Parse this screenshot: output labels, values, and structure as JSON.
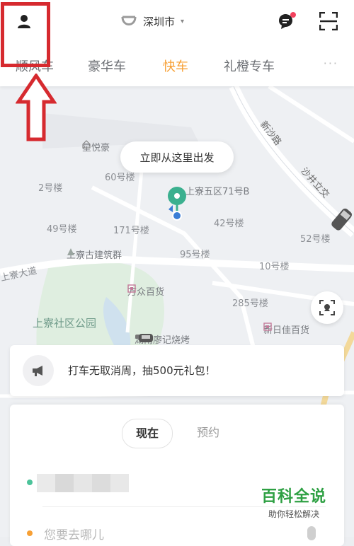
{
  "header": {
    "city": "深圳市",
    "city_caret": "▾"
  },
  "tabs": [
    {
      "label": "顺风车"
    },
    {
      "label": "豪华车"
    },
    {
      "label": "快车",
      "active": true
    },
    {
      "label": "礼橙专车"
    }
  ],
  "tabs_more": "···",
  "map": {
    "bubble": "立即从这里出发",
    "streets": [
      "新沙路",
      "沙井立交",
      "上寮大道"
    ],
    "buildings": [
      "60号楼",
      "2号楼",
      "42号楼",
      "49号楼",
      "171号楼",
      "52号楼",
      "95号楼",
      "10号楼",
      "285号楼"
    ],
    "pois": {
      "star": "星悦豪",
      "wuqu": "上寮五区71号B",
      "ancient": "上寮古建筑群",
      "wanzhong": "万众百货",
      "park": "上寮社区公园",
      "hunan": "湖南廖记烧烤",
      "xinri": "新日佳百货"
    }
  },
  "promo": {
    "text": "打车无取消周，抽500元礼包！"
  },
  "order": {
    "mode_now": "现在",
    "mode_reserve": "预约",
    "destination_placeholder": "您要去哪儿"
  },
  "watermark": {
    "title": "百科全说",
    "subtitle": "助你轻松解决"
  },
  "colors": {
    "accent": "#f7a035",
    "annotation": "#d62a2f",
    "pin": "#3bb08f",
    "watermark": "#2ea043"
  }
}
